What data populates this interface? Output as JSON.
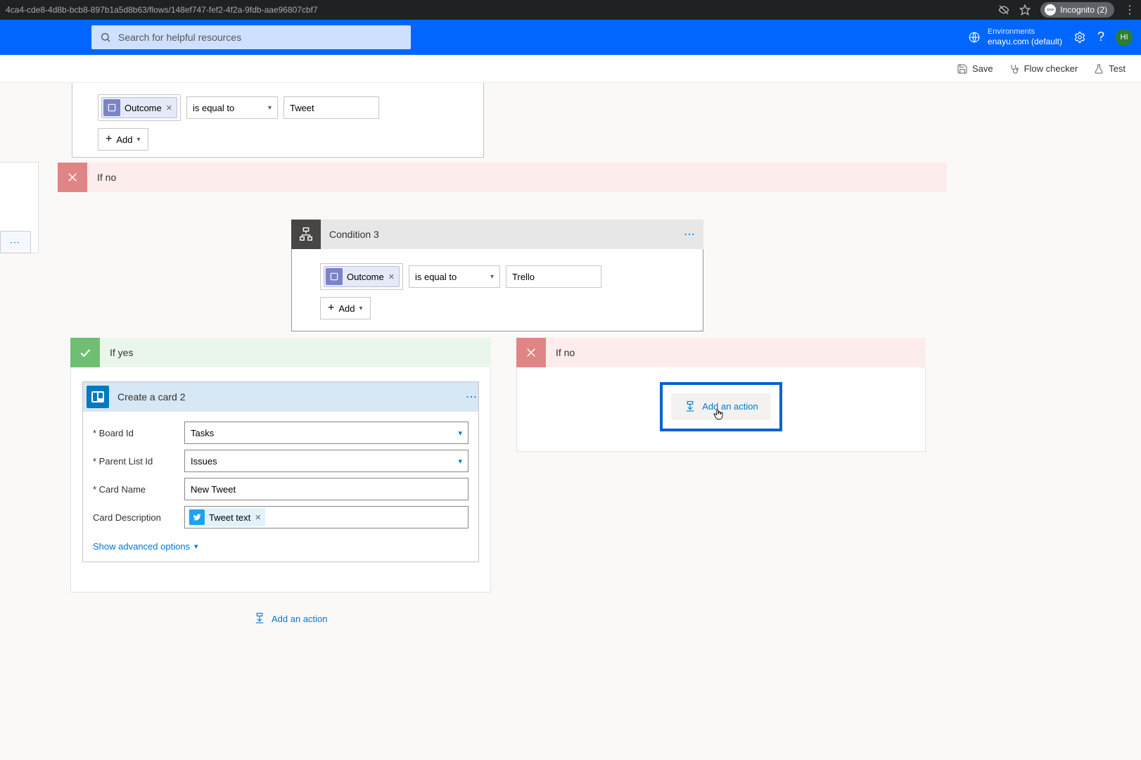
{
  "browser": {
    "url": "4ca4-cde8-4d8b-bcb8-897b1a5d8b63/flows/148ef747-fef2-4f2a-9fdb-aae96807cbf7",
    "incognito_label": "Incognito (2)"
  },
  "header": {
    "search_placeholder": "Search for helpful resources",
    "env_label": "Environments",
    "env_value": "enayu.com (default)",
    "avatar_initials": "HI"
  },
  "commands": {
    "save": "Save",
    "flow_checker": "Flow checker",
    "test": "Test"
  },
  "top_condition": {
    "token": "Outcome",
    "operator": "is equal to",
    "value": "Tweet",
    "add": "Add"
  },
  "branch": {
    "if_no": "If no",
    "if_yes": "If yes"
  },
  "condition3": {
    "title": "Condition 3",
    "token": "Outcome",
    "operator": "is equal to",
    "value": "Trello",
    "add": "Add"
  },
  "create_card": {
    "title": "Create a card 2",
    "labels": {
      "board": "Board Id",
      "parent": "Parent List Id",
      "card_name": "Card Name",
      "card_desc": "Card Description"
    },
    "values": {
      "board": "Tasks",
      "parent": "Issues",
      "card_name": "New Tweet",
      "desc_token": "Tweet text"
    },
    "show_adv": "Show advanced options"
  },
  "actions": {
    "add_action": "Add an action"
  },
  "misc": {
    "dots": "⋯"
  }
}
